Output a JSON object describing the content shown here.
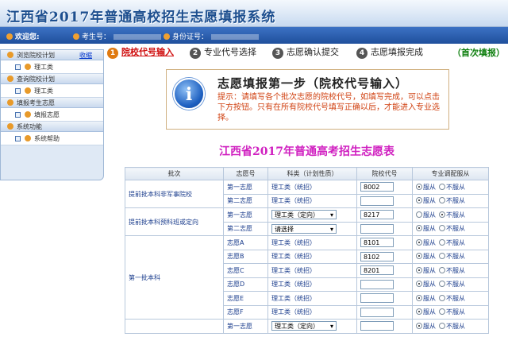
{
  "header": {
    "title": "江西省2017年普通高校招生志愿填报系统"
  },
  "topbar": {
    "welcome": "欢迎您:",
    "exam_no_label": "考生号：",
    "id_no_label": "身份证号："
  },
  "sidebar": {
    "sections": [
      {
        "title": "浏览院校计划",
        "link": "收缩",
        "items": [
          "理工类"
        ]
      },
      {
        "title": "查询院校计划",
        "items": [
          "理工类"
        ]
      },
      {
        "title": "填报考生志愿",
        "items": [
          "填报志愿"
        ]
      },
      {
        "title": "系统功能",
        "items": [
          "系统帮助"
        ]
      }
    ]
  },
  "steps": [
    {
      "num": "1",
      "label": "院校代号输入"
    },
    {
      "num": "2",
      "label": "专业代号选择"
    },
    {
      "num": "3",
      "label": "志愿确认提交"
    },
    {
      "num": "4",
      "label": "志愿填报完成"
    }
  ],
  "first_fill": "（首次填报）",
  "tip": {
    "title": "志愿填报第一步（院校代号输入）",
    "body": "提示：请填写各个批次志愿的院校代号，如填写完成，可以点击下方按钮。只有在所有院校代号填写正确以后，才能进入专业选择。"
  },
  "form_title": "江西省2017年普通高考招生志愿表",
  "table": {
    "headers": [
      "批次",
      "志愿号",
      "科类（计划性质）",
      "院校代号",
      "专业调配服从"
    ],
    "radio_yes": "服从",
    "radio_no": "不服从",
    "batches": [
      {
        "name": "提前批本科非军事院校",
        "rows": [
          {
            "zy": "第一志愿",
            "kl": "理工类（统招）",
            "code": "8002",
            "fc": true,
            "sel": false
          },
          {
            "zy": "第二志愿",
            "kl": "理工类（统招）",
            "code": "",
            "fc": true,
            "sel": false
          }
        ]
      },
      {
        "name": "提前批本科预科班或定向",
        "rows": [
          {
            "zy": "第一志愿",
            "kl": "理工类（定向）",
            "code": "8217",
            "fc": false,
            "sel": true
          },
          {
            "zy": "第二志愿",
            "kl": "请选择",
            "code": "",
            "fc": true,
            "sel": true
          }
        ]
      },
      {
        "name": "第一批本科",
        "rows": [
          {
            "zy": "志愿A",
            "kl": "理工类（统招）",
            "code": "8101",
            "fc": true,
            "sel": false
          },
          {
            "zy": "志愿B",
            "kl": "理工类（统招）",
            "code": "8102",
            "fc": true,
            "sel": false
          },
          {
            "zy": "志愿C",
            "kl": "理工类（统招）",
            "code": "8201",
            "fc": true,
            "sel": false
          },
          {
            "zy": "志愿D",
            "kl": "理工类（统招）",
            "code": "",
            "fc": true,
            "sel": false
          },
          {
            "zy": "志愿E",
            "kl": "理工类（统招）",
            "code": "",
            "fc": true,
            "sel": false
          },
          {
            "zy": "志愿F",
            "kl": "理工类（统招）",
            "code": "",
            "fc": true,
            "sel": false
          }
        ]
      },
      {
        "name": "",
        "rows": [
          {
            "zy": "第一志愿",
            "kl": "理工类（定向）",
            "code": "",
            "fc": true,
            "sel": true
          }
        ]
      }
    ]
  }
}
